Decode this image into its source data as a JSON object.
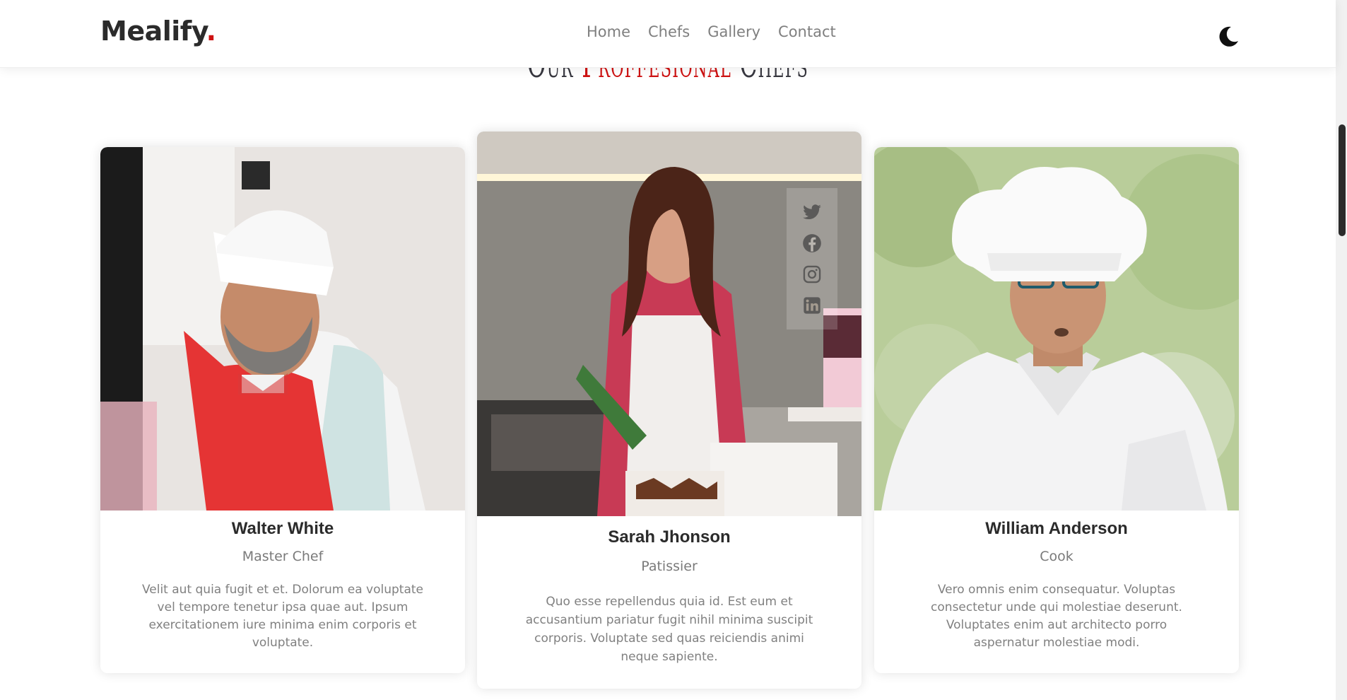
{
  "header": {
    "logo_text": "Mealify",
    "logo_dot": ".",
    "nav": [
      "Home",
      "Chefs",
      "Gallery",
      "Contact"
    ],
    "theme_icon": "moon-icon"
  },
  "section": {
    "title_part1": "Our ",
    "title_accent": "Proffesional",
    "title_part2": " Chefs"
  },
  "chefs": [
    {
      "name": "Walter White",
      "role": "Master Chef",
      "bio": "Velit aut quia fugit et et. Dolorum ea voluptate vel tempore tenetur ipsa quae aut. Ipsum exercitationem iure minima enim corporis et voluptate."
    },
    {
      "name": "Sarah Jhonson",
      "role": "Patissier",
      "bio": "Quo esse repellendus quia id. Est eum et accusantium pariatur fugit nihil minima suscipit corporis. Voluptate sed quas reiciendis animi neque sapiente.",
      "social_icons": [
        "twitter-icon",
        "facebook-icon",
        "instagram-icon",
        "linkedin-icon"
      ]
    },
    {
      "name": "William Anderson",
      "role": "Cook",
      "bio": "Vero omnis enim consequatur. Voluptas consectetur unde qui molestiae deserunt. Voluptates enim aut architecto porro aspernatur molestiae modi."
    }
  ],
  "colors": {
    "accent": "#ce1212",
    "text_dark": "#2b2b2b",
    "text_muted": "#808080"
  }
}
